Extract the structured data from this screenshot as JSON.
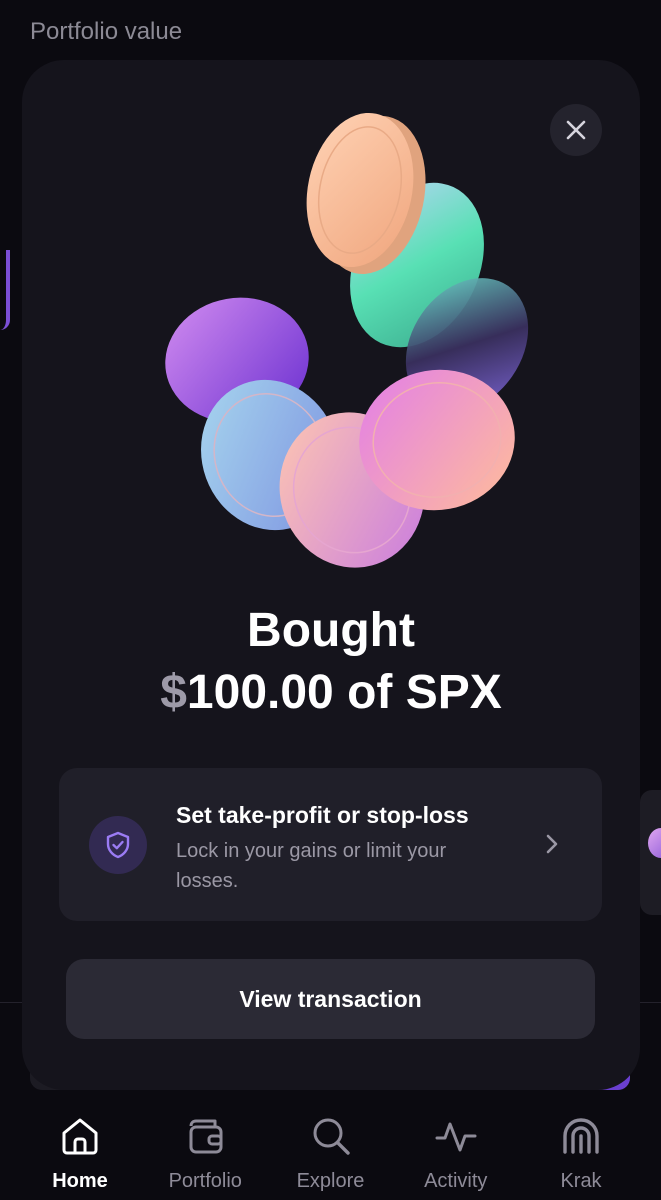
{
  "background": {
    "title": "Portfolio value"
  },
  "modal": {
    "headline_line1": "Bought",
    "currency_symbol": "$",
    "headline_amount": "100.00 of SPX",
    "promo": {
      "title": "Set take-profit or stop-loss",
      "subtitle": "Lock in your gains or limit your losses."
    },
    "view_button": "View transaction"
  },
  "nav": {
    "items": [
      {
        "label": "Home",
        "icon": "home-icon",
        "active": true
      },
      {
        "label": "Portfolio",
        "icon": "wallet-icon",
        "active": false
      },
      {
        "label": "Explore",
        "icon": "search-icon",
        "active": false
      },
      {
        "label": "Activity",
        "icon": "activity-icon",
        "active": false
      },
      {
        "label": "Krak",
        "icon": "krak-icon",
        "active": false
      }
    ]
  },
  "colors": {
    "background": "#0b0a10",
    "modal": "#15141c",
    "card": "#201f29",
    "accent": "#8c6cf0",
    "muted_text": "#9b98a5"
  }
}
